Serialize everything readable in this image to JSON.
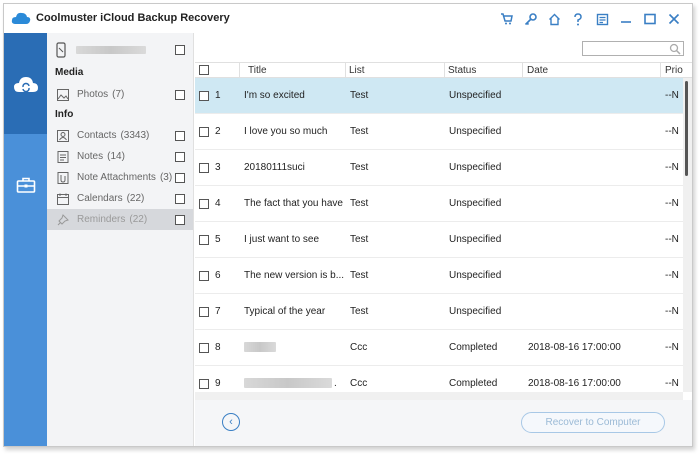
{
  "window": {
    "title": "Coolmuster iCloud Backup Recovery"
  },
  "toolbar_icons": [
    "cart-icon",
    "key-icon",
    "home-icon",
    "help-icon",
    "feedback-icon",
    "minimize-icon",
    "maximize-icon",
    "close-icon"
  ],
  "colors": {
    "accent": "#3a7fc4",
    "nav_bg": "#4a90d9",
    "nav_active": "#2a6db5",
    "selected_row": "#cfe8f3"
  },
  "categories": {
    "media_label": "Media",
    "info_label": "Info",
    "items": [
      {
        "label": "Photos",
        "count": "(7)",
        "icon": "photo-icon"
      },
      {
        "label": "Contacts",
        "count": "(3343)",
        "icon": "contacts-icon"
      },
      {
        "label": "Notes",
        "count": "(14)",
        "icon": "notes-icon"
      },
      {
        "label": "Note Attachments",
        "count": "(3)",
        "icon": "attachment-icon"
      },
      {
        "label": "Calendars",
        "count": "(22)",
        "icon": "calendar-icon"
      },
      {
        "label": "Reminders",
        "count": "(22)",
        "icon": "pin-icon"
      }
    ]
  },
  "table": {
    "headers": [
      "Title",
      "List",
      "Status",
      "Date",
      "Prio"
    ],
    "rows": [
      {
        "num": "1",
        "title": "I'm so excited",
        "list": "Test",
        "status": "Unspecified",
        "date": "",
        "prio": "--N"
      },
      {
        "num": "2",
        "title": "I love you so much",
        "list": "Test",
        "status": "Unspecified",
        "date": "",
        "prio": "--N"
      },
      {
        "num": "3",
        "title": "20180111suci",
        "list": "Test",
        "status": "Unspecified",
        "date": "",
        "prio": "--N"
      },
      {
        "num": "4",
        "title": "The fact that you have",
        "list": "Test",
        "status": "Unspecified",
        "date": "",
        "prio": "--N"
      },
      {
        "num": "5",
        "title": "I just want to see",
        "list": "Test",
        "status": "Unspecified",
        "date": "",
        "prio": "--N"
      },
      {
        "num": "6",
        "title": "The new version is b...",
        "list": "Test",
        "status": "Unspecified",
        "date": "",
        "prio": "--N"
      },
      {
        "num": "7",
        "title": "Typical of the year",
        "list": "Test",
        "status": "Unspecified",
        "date": "",
        "prio": "--N"
      },
      {
        "num": "8",
        "title": "",
        "list": "Ccc",
        "status": "Completed",
        "date": "2018-08-16 17:00:00",
        "prio": "--N"
      },
      {
        "num": "9",
        "title": ".",
        "list": "Ccc",
        "status": "Completed",
        "date": "2018-08-16 17:00:00",
        "prio": "--N"
      }
    ]
  },
  "footer": {
    "recover_label": "Recover to Computer"
  }
}
